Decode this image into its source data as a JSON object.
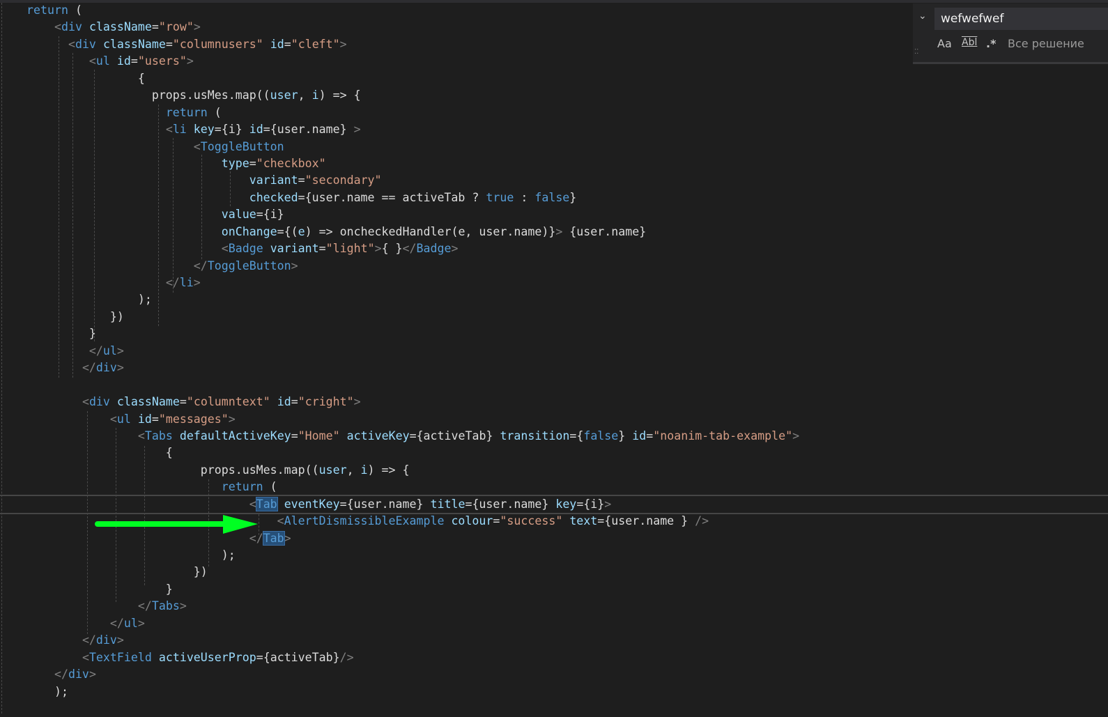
{
  "find_widget": {
    "search_value": "wefwefwef",
    "match_case_icon_label": "Aa",
    "whole_word_icon_label": "Abl",
    "regex_icon_label": ".*",
    "scope_label": "Все решение"
  },
  "code": {
    "current_line": 29,
    "lines": [
      [
        [
          "x",
          ""
        ],
        [
          "k",
          "return"
        ],
        [
          "x",
          " ("
        ]
      ],
      [
        [
          "x",
          "    "
        ],
        [
          "p",
          "<"
        ],
        [
          "t",
          "div"
        ],
        [
          "x",
          " "
        ],
        [
          "a",
          "className"
        ],
        [
          "x",
          "="
        ],
        [
          "s",
          "\"row\""
        ],
        [
          "p",
          ">"
        ]
      ],
      [
        [
          "x",
          "      "
        ],
        [
          "p",
          "<"
        ],
        [
          "t",
          "div"
        ],
        [
          "x",
          " "
        ],
        [
          "a",
          "className"
        ],
        [
          "x",
          "="
        ],
        [
          "s",
          "\"columnusers\""
        ],
        [
          "x",
          " "
        ],
        [
          "a",
          "id"
        ],
        [
          "x",
          "="
        ],
        [
          "s",
          "\"cleft\""
        ],
        [
          "p",
          ">"
        ]
      ],
      [
        [
          "x",
          "         "
        ],
        [
          "p",
          "<"
        ],
        [
          "t",
          "ul"
        ],
        [
          "x",
          " "
        ],
        [
          "a",
          "id"
        ],
        [
          "x",
          "="
        ],
        [
          "s",
          "\"users\""
        ],
        [
          "p",
          ">"
        ]
      ],
      [
        [
          "x",
          "                {"
        ]
      ],
      [
        [
          "x",
          "                  props.usMes.map(("
        ],
        [
          "v",
          "user"
        ],
        [
          "x",
          ", "
        ],
        [
          "v",
          "i"
        ],
        [
          "x",
          ") => {"
        ]
      ],
      [
        [
          "x",
          "                    "
        ],
        [
          "k",
          "return"
        ],
        [
          "x",
          " ("
        ]
      ],
      [
        [
          "x",
          "                    "
        ],
        [
          "p",
          "<"
        ],
        [
          "t",
          "li"
        ],
        [
          "x",
          " "
        ],
        [
          "a",
          "key"
        ],
        [
          "x",
          "={i} "
        ],
        [
          "a",
          "id"
        ],
        [
          "x",
          "={user.name} "
        ],
        [
          "p",
          ">"
        ]
      ],
      [
        [
          "x",
          "                        "
        ],
        [
          "p",
          "<"
        ],
        [
          "t",
          "ToggleButton"
        ]
      ],
      [
        [
          "x",
          "                            "
        ],
        [
          "a",
          "type"
        ],
        [
          "x",
          "="
        ],
        [
          "s",
          "\"checkbox\""
        ]
      ],
      [
        [
          "x",
          "                                "
        ],
        [
          "a",
          "variant"
        ],
        [
          "x",
          "="
        ],
        [
          "s",
          "\"secondary\""
        ]
      ],
      [
        [
          "x",
          "                                "
        ],
        [
          "a",
          "checked"
        ],
        [
          "x",
          "={user.name == activeTab ? "
        ],
        [
          "k",
          "true"
        ],
        [
          "x",
          " : "
        ],
        [
          "k",
          "false"
        ],
        [
          "x",
          "}"
        ]
      ],
      [
        [
          "x",
          "                            "
        ],
        [
          "a",
          "value"
        ],
        [
          "x",
          "={i}"
        ]
      ],
      [
        [
          "x",
          "                            "
        ],
        [
          "a",
          "onChange"
        ],
        [
          "x",
          "={("
        ],
        [
          "v",
          "e"
        ],
        [
          "x",
          ") => oncheckedHandler(e, user.name)}"
        ],
        [
          "p",
          ">"
        ],
        [
          "x",
          " {user.name}"
        ]
      ],
      [
        [
          "x",
          "                            "
        ],
        [
          "p",
          "<"
        ],
        [
          "t",
          "Badge"
        ],
        [
          "x",
          " "
        ],
        [
          "a",
          "variant"
        ],
        [
          "x",
          "="
        ],
        [
          "s",
          "\"light\""
        ],
        [
          "p",
          ">"
        ],
        [
          "x",
          "{ }"
        ],
        [
          "p",
          "</"
        ],
        [
          "t",
          "Badge"
        ],
        [
          "p",
          ">"
        ]
      ],
      [
        [
          "x",
          "                        "
        ],
        [
          "p",
          "</"
        ],
        [
          "t",
          "ToggleButton"
        ],
        [
          "p",
          ">"
        ]
      ],
      [
        [
          "x",
          "                    "
        ],
        [
          "p",
          "</"
        ],
        [
          "t",
          "li"
        ],
        [
          "p",
          ">"
        ]
      ],
      [
        [
          "x",
          "                );"
        ]
      ],
      [
        [
          "x",
          "            })"
        ]
      ],
      [
        [
          "x",
          "         }"
        ]
      ],
      [
        [
          "x",
          "         "
        ],
        [
          "p",
          "</"
        ],
        [
          "t",
          "ul"
        ],
        [
          "p",
          ">"
        ]
      ],
      [
        [
          "x",
          "        "
        ],
        [
          "p",
          "</"
        ],
        [
          "t",
          "div"
        ],
        [
          "p",
          ">"
        ]
      ],
      [
        [
          "x",
          ""
        ]
      ],
      [
        [
          "x",
          "        "
        ],
        [
          "p",
          "<"
        ],
        [
          "t",
          "div"
        ],
        [
          "x",
          " "
        ],
        [
          "a",
          "className"
        ],
        [
          "x",
          "="
        ],
        [
          "s",
          "\"columntext\""
        ],
        [
          "x",
          " "
        ],
        [
          "a",
          "id"
        ],
        [
          "x",
          "="
        ],
        [
          "s",
          "\"cright\""
        ],
        [
          "p",
          ">"
        ]
      ],
      [
        [
          "x",
          "            "
        ],
        [
          "p",
          "<"
        ],
        [
          "t",
          "ul"
        ],
        [
          "x",
          " "
        ],
        [
          "a",
          "id"
        ],
        [
          "x",
          "="
        ],
        [
          "s",
          "\"messages\""
        ],
        [
          "p",
          ">"
        ]
      ],
      [
        [
          "x",
          "                "
        ],
        [
          "p",
          "<"
        ],
        [
          "t",
          "Tabs"
        ],
        [
          "x",
          " "
        ],
        [
          "a",
          "defaultActiveKey"
        ],
        [
          "x",
          "="
        ],
        [
          "s",
          "\"Home\""
        ],
        [
          "x",
          " "
        ],
        [
          "a",
          "activeKey"
        ],
        [
          "x",
          "={activeTab} "
        ],
        [
          "a",
          "transition"
        ],
        [
          "x",
          "={"
        ],
        [
          "k",
          "false"
        ],
        [
          "x",
          "} "
        ],
        [
          "a",
          "id"
        ],
        [
          "x",
          "="
        ],
        [
          "s",
          "\"noanim-tab-example\""
        ],
        [
          "p",
          ">"
        ]
      ],
      [
        [
          "x",
          "                    {"
        ]
      ],
      [
        [
          "x",
          "                         props.usMes.map(("
        ],
        [
          "v",
          "user"
        ],
        [
          "x",
          ", "
        ],
        [
          "v",
          "i"
        ],
        [
          "x",
          ") => {"
        ]
      ],
      [
        [
          "x",
          "                            "
        ],
        [
          "k",
          "return"
        ],
        [
          "x",
          " ("
        ]
      ],
      [
        [
          "x",
          "                                "
        ],
        [
          "p",
          "<"
        ],
        [
          "hl",
          "Tab"
        ],
        [
          "x",
          " "
        ],
        [
          "a",
          "eventKey"
        ],
        [
          "x",
          "={user.name} "
        ],
        [
          "a",
          "title"
        ],
        [
          "x",
          "={user.name} "
        ],
        [
          "a",
          "key"
        ],
        [
          "x",
          "={i}"
        ],
        [
          "p",
          ">"
        ]
      ],
      [
        [
          "x",
          "                                    "
        ],
        [
          "p",
          "<"
        ],
        [
          "t",
          "AlertDismissibleExample"
        ],
        [
          "x",
          " "
        ],
        [
          "a",
          "colour"
        ],
        [
          "x",
          "="
        ],
        [
          "s",
          "\"success\""
        ],
        [
          "x",
          " "
        ],
        [
          "a",
          "text"
        ],
        [
          "x",
          "={user.name } "
        ],
        [
          "p",
          "/>"
        ]
      ],
      [
        [
          "x",
          "                                "
        ],
        [
          "p",
          "</"
        ],
        [
          "hl",
          "Tab"
        ],
        [
          "p",
          ">"
        ]
      ],
      [
        [
          "x",
          "                            );"
        ]
      ],
      [
        [
          "x",
          "                        })"
        ]
      ],
      [
        [
          "x",
          "                    }"
        ]
      ],
      [
        [
          "x",
          "                "
        ],
        [
          "p",
          "</"
        ],
        [
          "t",
          "Tabs"
        ],
        [
          "p",
          ">"
        ]
      ],
      [
        [
          "x",
          "            "
        ],
        [
          "p",
          "</"
        ],
        [
          "t",
          "ul"
        ],
        [
          "p",
          ">"
        ]
      ],
      [
        [
          "x",
          "        "
        ],
        [
          "p",
          "</"
        ],
        [
          "t",
          "div"
        ],
        [
          "p",
          ">"
        ]
      ],
      [
        [
          "x",
          "        "
        ],
        [
          "p",
          "<"
        ],
        [
          "t",
          "TextField"
        ],
        [
          "x",
          " "
        ],
        [
          "a",
          "activeUserProp"
        ],
        [
          "x",
          "={activeTab}"
        ],
        [
          "p",
          "/>"
        ]
      ],
      [
        [
          "x",
          "    "
        ],
        [
          "p",
          "</"
        ],
        [
          "t",
          "div"
        ],
        [
          "p",
          ">"
        ]
      ],
      [
        [
          "x",
          "    );"
        ]
      ]
    ]
  },
  "colors": {
    "background": "#1e1e1e",
    "keyword": "#569cd6",
    "attribute": "#9cdcfe",
    "string": "#d69d85",
    "annotation_arrow": "#00ff22"
  }
}
